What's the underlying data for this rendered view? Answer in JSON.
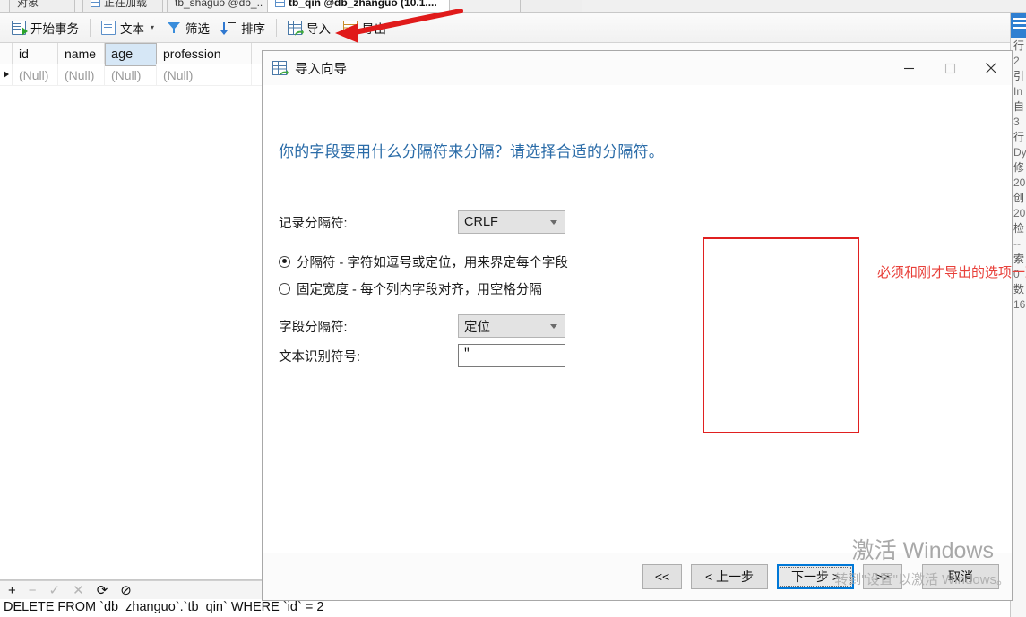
{
  "window": {
    "tabs": [
      {
        "label": "对象",
        "active": false
      },
      {
        "label": "正在加载",
        "active": false
      },
      {
        "label": "tb_shaguo @db_...",
        "active": false
      },
      {
        "label": "tb_qin @db_zhanguo (10.1....",
        "active": true
      }
    ]
  },
  "toolbar": {
    "items": [
      {
        "label": "开始事务",
        "icon": "transaction-icon",
        "caret": ""
      },
      {
        "label": "文本",
        "icon": "text-doc-icon",
        "caret": "▾"
      },
      {
        "label": "筛选",
        "icon": "filter-icon",
        "caret": ""
      },
      {
        "label": "排序",
        "icon": "sort-icon",
        "caret": ""
      },
      {
        "label": "导入",
        "icon": "import-grid-icon",
        "caret": ""
      },
      {
        "label": "导出",
        "icon": "export-grid-icon",
        "caret": ""
      }
    ]
  },
  "grid": {
    "columns": [
      "id",
      "name",
      "age",
      "profession"
    ],
    "selected_column": "age",
    "rows": [
      [
        "(Null)",
        "(Null)",
        "(Null)",
        "(Null)"
      ]
    ]
  },
  "record_nav": {
    "add": "+",
    "remove": "−",
    "confirm": "✓",
    "cancel": "✕",
    "refresh": "⟳",
    "stop": "⊘"
  },
  "status_bar": {
    "sql": "DELETE FROM `db_zhanguo`.`tb_qin` WHERE `id` = 2"
  },
  "right_panel": {
    "lines": [
      "行",
      "2",
      "引",
      "In",
      "自",
      "3",
      "行",
      "Dy",
      "修",
      "20",
      "创",
      "20",
      "检",
      "--",
      "索",
      "0",
      "数",
      "16"
    ]
  },
  "dialog": {
    "title": "导入向导",
    "title_icon": "import-wizard-icon",
    "minimize_label": "—",
    "maximize_label": "▢",
    "close_label": "✕",
    "heading": "你的字段要用什么分隔符来分隔？请选择合适的分隔符。",
    "fields": {
      "record_delimiter_label": "记录分隔符:",
      "record_delimiter_value": "CRLF",
      "field_delimiter_label": "字段分隔符:",
      "field_delimiter_value": "定位",
      "text_qualifier_label": "文本识别符号:",
      "text_qualifier_value": "\""
    },
    "radios": [
      {
        "label": "分隔符 - 字符如逗号或定位，用来界定每个字段",
        "checked": true
      },
      {
        "label": "固定宽度 - 每个列内字段对齐，用空格分隔",
        "checked": false
      }
    ],
    "annotation": "必须和刚才导出的选项一致",
    "annotation_color": "#e8403a",
    "buttons": [
      {
        "label": "<<",
        "primary": false,
        "wide": false
      },
      {
        "label": "< 上一步",
        "primary": false,
        "wide": true
      },
      {
        "label": "下一步 >",
        "primary": true,
        "wide": true
      },
      {
        "label": ">>",
        "primary": false,
        "wide": false
      },
      {
        "label": "取消",
        "primary": false,
        "wide": true
      }
    ]
  },
  "watermark": {
    "line1": "激活 Windows",
    "line2": "转到\"设置\"以激活 Windows。"
  }
}
